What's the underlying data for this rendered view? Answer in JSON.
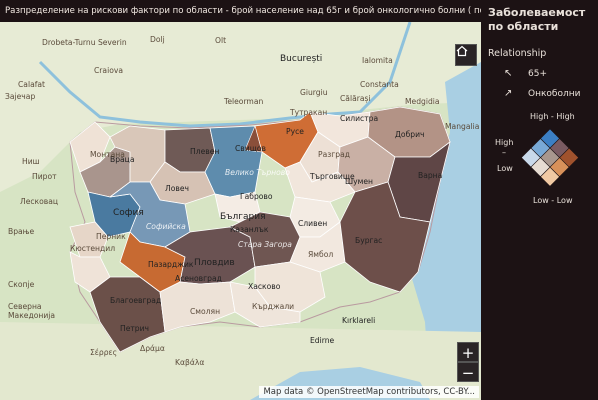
{
  "title": "Разпределение на рискови фактори по области - брой население над 65г и брой онкологично болни ( по данни на НСИ)",
  "legend": {
    "title": "Заболеваемост по области",
    "relationship_label": "Relationship",
    "series": [
      {
        "label": "65+",
        "arrow": "↖",
        "color": "#2d78c8"
      },
      {
        "label": "Онкоболни",
        "arrow": "↗",
        "color": "#d8732a"
      }
    ],
    "corners": {
      "top": "High - High",
      "left_top": "High",
      "left_mid": "–",
      "left_bottom": "Low",
      "bottom": "Low - Low"
    },
    "grid_colors": [
      [
        "#3c7fc4",
        "#7a5b62",
        "#a0522d"
      ],
      [
        "#79a9d6",
        "#a8978e",
        "#d8915a"
      ],
      [
        "#c9d9ea",
        "#e6dcd2",
        "#f0c9a3"
      ]
    ]
  },
  "controls": {
    "home_icon": "home-icon",
    "zoom_in": "+",
    "zoom_out": "−"
  },
  "attribution": "Map data © OpenStreetMap contributors, CC-BY...",
  "labels": {
    "cities": [
      {
        "id": "bucuresti",
        "text": "București"
      },
      {
        "id": "constanta",
        "text": "Constanta"
      },
      {
        "id": "sofia",
        "text": "София"
      },
      {
        "id": "varna",
        "text": "Варна"
      },
      {
        "id": "plovdiv",
        "text": "Пловдив"
      },
      {
        "id": "burgas",
        "text": "Бургас"
      },
      {
        "id": "ruse",
        "text": "Русе"
      },
      {
        "id": "pleven",
        "text": "Плевен"
      },
      {
        "id": "vtarnovo",
        "text": "Велико Търново"
      },
      {
        "id": "shumen",
        "text": "Шумен"
      },
      {
        "id": "kazanlak",
        "text": "Казанлък"
      },
      {
        "id": "stara",
        "text": "Стара Загора"
      },
      {
        "id": "haskovo",
        "text": "Хасково"
      },
      {
        "id": "pazardzhik",
        "text": "Пазарджик"
      },
      {
        "id": "blagoevgrad",
        "text": "Благоевград"
      },
      {
        "id": "asenovgrad",
        "text": "Асеновград"
      },
      {
        "id": "vraca",
        "text": "Враца"
      },
      {
        "id": "montana",
        "text": "Монтана"
      },
      {
        "id": "lovech",
        "text": "Ловеч"
      },
      {
        "id": "gabrovo",
        "text": "Габрово"
      },
      {
        "id": "targovishte",
        "text": "Търговище"
      },
      {
        "id": "razgrad",
        "text": "Разград"
      },
      {
        "id": "silistra",
        "text": "Силистра"
      },
      {
        "id": "dobrich",
        "text": "Добрич"
      },
      {
        "id": "sliven",
        "text": "Сливен"
      },
      {
        "id": "yambol",
        "text": "Ямбол"
      },
      {
        "id": "kardzhali",
        "text": "Кърджали"
      },
      {
        "id": "smolyan",
        "text": "Смолян"
      },
      {
        "id": "kyustendil",
        "text": "Кюстендил"
      },
      {
        "id": "pernik",
        "text": "Перник"
      },
      {
        "id": "sofiyska",
        "text": "Софийска"
      },
      {
        "id": "svishtov",
        "text": "Свищов"
      },
      {
        "id": "teleorman",
        "text": "Teleorman"
      },
      {
        "id": "dolj",
        "text": "Dolj"
      },
      {
        "id": "olt",
        "text": "Olt"
      },
      {
        "id": "giurgiu",
        "text": "Giurgiu"
      },
      {
        "id": "calarasi",
        "text": "Călărași"
      },
      {
        "id": "ialomita",
        "text": "Ialomita"
      },
      {
        "id": "drobeta",
        "text": "Drobeta-Turnu Severin"
      },
      {
        "id": "craiova",
        "text": "Craiova"
      },
      {
        "id": "nish",
        "text": "Ниш"
      },
      {
        "id": "leskovac",
        "text": "Лесковац"
      },
      {
        "id": "vranje",
        "text": "Врање"
      },
      {
        "id": "skopje",
        "text": "Скопје"
      },
      {
        "id": "kirklareli",
        "text": "Kırklareli"
      },
      {
        "id": "edirne",
        "text": "Edirne"
      },
      {
        "id": "kavala",
        "text": "Καβάλα"
      },
      {
        "id": "drama",
        "text": "Δράμα"
      },
      {
        "id": "serres",
        "text": "Σέρρες"
      },
      {
        "id": "petrich",
        "text": "Петрич"
      },
      {
        "id": "severna",
        "text": "Северна Македонија"
      },
      {
        "id": "zaj",
        "text": "Зајечар"
      },
      {
        "id": "pirot",
        "text": "Пирот"
      },
      {
        "id": "bulgaria",
        "text": "България"
      },
      {
        "id": "tutrakan",
        "text": "Тутракан"
      },
      {
        "id": "medgidia",
        "text": "Medgidia"
      },
      {
        "id": "mangalia",
        "text": "Mangalia"
      },
      {
        "id": "calafat",
        "text": "Calafat"
      }
    ]
  }
}
